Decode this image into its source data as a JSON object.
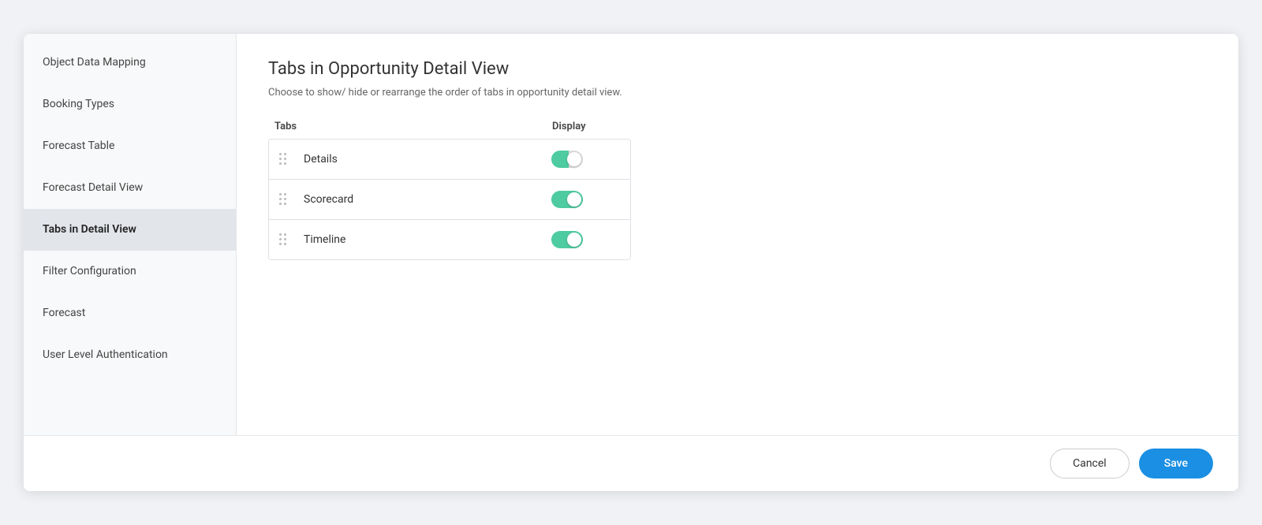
{
  "sidebar": {
    "items": [
      {
        "id": "object-data-mapping",
        "label": "Object Data Mapping",
        "active": false
      },
      {
        "id": "booking-types",
        "label": "Booking Types",
        "active": false
      },
      {
        "id": "forecast-table",
        "label": "Forecast Table",
        "active": false
      },
      {
        "id": "forecast-detail-view",
        "label": "Forecast Detail View",
        "active": false
      },
      {
        "id": "tabs-in-detail-view",
        "label": "Tabs in Detail View",
        "active": true
      },
      {
        "id": "filter-configuration",
        "label": "Filter Configuration",
        "active": false
      },
      {
        "id": "forecast",
        "label": "Forecast",
        "active": false
      },
      {
        "id": "user-level-authentication",
        "label": "User Level Authentication",
        "active": false
      }
    ]
  },
  "main": {
    "title": "Tabs in Opportunity Detail View",
    "description": "Choose to show/ hide or rearrange the order of tabs in opportunity detail view.",
    "columns": {
      "tabs": "Tabs",
      "display": "Display"
    },
    "rows": [
      {
        "id": "details",
        "label": "Details",
        "enabled": true,
        "partial": true
      },
      {
        "id": "scorecard",
        "label": "Scorecard",
        "enabled": true,
        "partial": false
      },
      {
        "id": "timeline",
        "label": "Timeline",
        "enabled": true,
        "partial": false
      }
    ]
  },
  "footer": {
    "cancel_label": "Cancel",
    "save_label": "Save"
  }
}
